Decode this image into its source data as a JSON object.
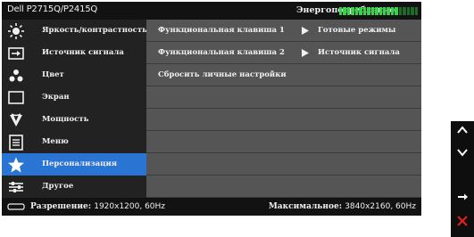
{
  "header": {
    "model": "Dell P2715Q/P2415Q",
    "energy_label": "Энергопотребление",
    "energy_level": 0.75,
    "energy_segments": 20,
    "energy_on_color": "#39d24a",
    "energy_off_color": "#1d6b26"
  },
  "menu": {
    "active_color": "#2a74d4",
    "items": [
      {
        "label": "Яркость/контрастность",
        "icon": "sun-icon"
      },
      {
        "label": "Источник сигнала",
        "icon": "input-source-icon"
      },
      {
        "label": "Цвет",
        "icon": "color-dots-icon"
      },
      {
        "label": "Экран",
        "icon": "display-icon"
      },
      {
        "label": "Мощность",
        "icon": "power-icon"
      },
      {
        "label": "Меню",
        "icon": "menu-list-icon"
      },
      {
        "label": "Персонализация",
        "icon": "star-icon",
        "active": true
      },
      {
        "label": "Другое",
        "icon": "sliders-icon"
      }
    ]
  },
  "content": {
    "rows": [
      {
        "label": "Функциональная клавиша 1",
        "value": "Готовые режимы"
      },
      {
        "label": "Функциональная клавиша 2",
        "value": "Источник сигнала"
      },
      {
        "label": "Сбросить личные настройки",
        "value": ""
      },
      {
        "label": "",
        "value": ""
      },
      {
        "label": "",
        "value": ""
      },
      {
        "label": "",
        "value": ""
      },
      {
        "label": "",
        "value": ""
      },
      {
        "label": "",
        "value": ""
      }
    ]
  },
  "footer": {
    "resolution_label": "Разрешение:",
    "resolution_value": "1920x1200, 60Hz",
    "max_label": "Максимальное:",
    "max_value": "3840x2160, 60Hz"
  },
  "side_buttons": [
    {
      "icon": "chevron-up-icon"
    },
    {
      "icon": "chevron-down-icon"
    },
    {
      "icon": "arrow-right-icon"
    },
    {
      "icon": "close-icon",
      "color": "#e02020"
    }
  ]
}
